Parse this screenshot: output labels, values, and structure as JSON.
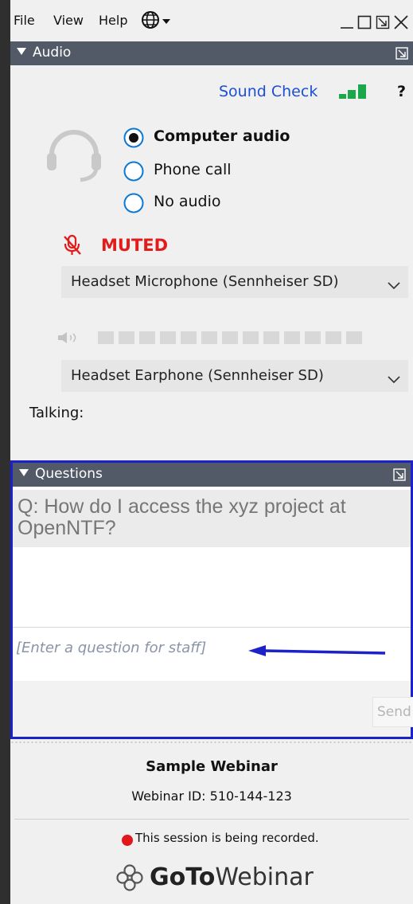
{
  "menu": {
    "file": "File",
    "view": "View",
    "help": "Help"
  },
  "audio": {
    "header": "Audio",
    "sound_check": "Sound Check",
    "help": "?",
    "options": [
      {
        "label": "Computer audio",
        "selected": true
      },
      {
        "label": "Phone call",
        "selected": false
      },
      {
        "label": "No audio",
        "selected": false
      }
    ],
    "muted_label": "MUTED",
    "microphone": "Headset Microphone (Sennheiser SD)",
    "speaker": "Headset Earphone (Sennheiser SD)",
    "talking_label": "Talking:",
    "level_segments": 13
  },
  "questions": {
    "header": "Questions",
    "question": "Q: How do I access the xyz project at OpenNTF?",
    "input_placeholder": "[Enter a question for staff]",
    "send": "Send"
  },
  "footer": {
    "webinar_title": "Sample Webinar",
    "webinar_id": "Webinar ID: 510-144-123",
    "recording": "This session is being recorded.",
    "logo_bold": "GoTo",
    "logo_rest": "Webinar"
  },
  "colors": {
    "header_bg": "#515a66",
    "link": "#1a4fd6",
    "muted_red": "#e31b1b",
    "frame_blue": "#1c22c8",
    "signal_green": "#1aa84a"
  }
}
